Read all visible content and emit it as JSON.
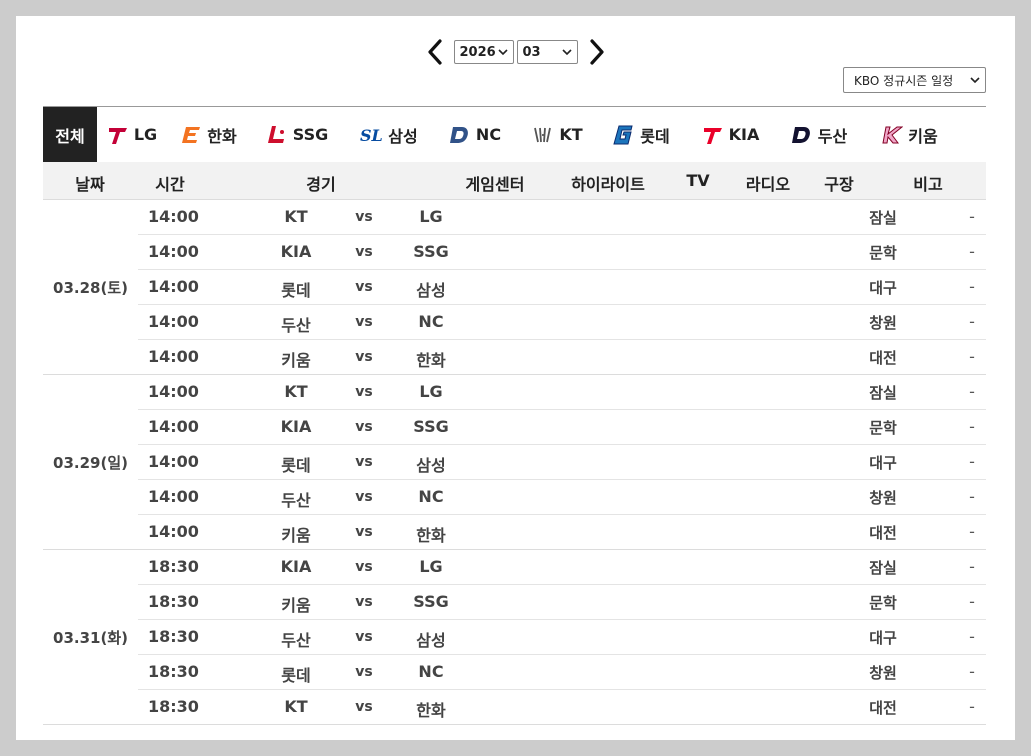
{
  "nav": {
    "year": "2026",
    "month": "03"
  },
  "league_select": "KBO 정규시즌 일정",
  "teams": [
    {
      "label": "전체",
      "logo": "none",
      "color": "#ffffff"
    },
    {
      "label": "LG",
      "logo": "T",
      "color": "#c30037"
    },
    {
      "label": "한화",
      "logo": "E",
      "color": "#f37321"
    },
    {
      "label": "SSG",
      "logo": "L",
      "color": "#ce0e2d"
    },
    {
      "label": "삼성",
      "logo": "SL",
      "color": "#074ca1"
    },
    {
      "label": "NC",
      "logo": "D",
      "color": "#315288"
    },
    {
      "label": "KT",
      "logo": "KW",
      "color": "#555555"
    },
    {
      "label": "롯데",
      "logo": "G",
      "color": "#0a2a6e"
    },
    {
      "label": "KIA",
      "logo": "T",
      "color": "#ea0029"
    },
    {
      "label": "두산",
      "logo": "D",
      "color": "#131230"
    },
    {
      "label": "키움",
      "logo": "K",
      "color": "#820024"
    }
  ],
  "headers": {
    "date": "날짜",
    "time": "시간",
    "game": "경기",
    "gamecenter": "게임센터",
    "highlight": "하이라이트",
    "tv": "TV",
    "radio": "라디오",
    "stadium": "구장",
    "note": "비고"
  },
  "days": [
    {
      "date": "03.28(토)",
      "games": [
        {
          "time": "14:00",
          "away": "KT",
          "vs": "vs",
          "home": "LG",
          "stadium": "잠실",
          "note": "-"
        },
        {
          "time": "14:00",
          "away": "KIA",
          "vs": "vs",
          "home": "SSG",
          "stadium": "문학",
          "note": "-"
        },
        {
          "time": "14:00",
          "away": "롯데",
          "vs": "vs",
          "home": "삼성",
          "stadium": "대구",
          "note": "-"
        },
        {
          "time": "14:00",
          "away": "두산",
          "vs": "vs",
          "home": "NC",
          "stadium": "창원",
          "note": "-"
        },
        {
          "time": "14:00",
          "away": "키움",
          "vs": "vs",
          "home": "한화",
          "stadium": "대전",
          "note": "-"
        }
      ]
    },
    {
      "date": "03.29(일)",
      "games": [
        {
          "time": "14:00",
          "away": "KT",
          "vs": "vs",
          "home": "LG",
          "stadium": "잠실",
          "note": "-"
        },
        {
          "time": "14:00",
          "away": "KIA",
          "vs": "vs",
          "home": "SSG",
          "stadium": "문학",
          "note": "-"
        },
        {
          "time": "14:00",
          "away": "롯데",
          "vs": "vs",
          "home": "삼성",
          "stadium": "대구",
          "note": "-"
        },
        {
          "time": "14:00",
          "away": "두산",
          "vs": "vs",
          "home": "NC",
          "stadium": "창원",
          "note": "-"
        },
        {
          "time": "14:00",
          "away": "키움",
          "vs": "vs",
          "home": "한화",
          "stadium": "대전",
          "note": "-"
        }
      ]
    },
    {
      "date": "03.31(화)",
      "games": [
        {
          "time": "18:30",
          "away": "KIA",
          "vs": "vs",
          "home": "LG",
          "stadium": "잠실",
          "note": "-"
        },
        {
          "time": "18:30",
          "away": "키움",
          "vs": "vs",
          "home": "SSG",
          "stadium": "문학",
          "note": "-"
        },
        {
          "time": "18:30",
          "away": "두산",
          "vs": "vs",
          "home": "삼성",
          "stadium": "대구",
          "note": "-"
        },
        {
          "time": "18:30",
          "away": "롯데",
          "vs": "vs",
          "home": "NC",
          "stadium": "창원",
          "note": "-"
        },
        {
          "time": "18:30",
          "away": "KT",
          "vs": "vs",
          "home": "한화",
          "stadium": "대전",
          "note": "-"
        }
      ]
    }
  ]
}
